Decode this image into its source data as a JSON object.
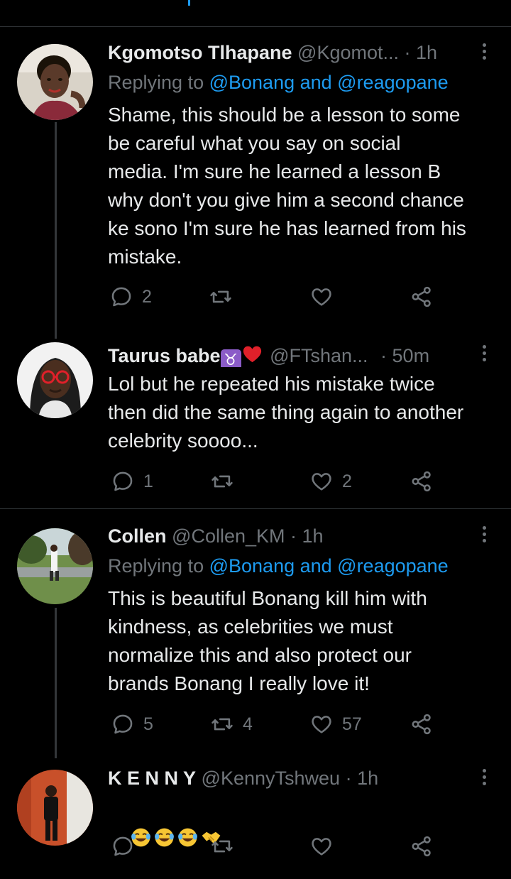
{
  "tweets": [
    {
      "name": "Kgomotso Tlhapane",
      "handle": "@Kgomot...",
      "time": "· 1h",
      "replying_label": "Replying to",
      "replying_to": "@Bonang and @reagopane",
      "text": "Shame, this should be a lesson to some\nbe careful what you say on social\nmedia. I'm sure he learned a lesson B\nwhy don't you give him a second chance\nke sono I'm sure he has learned from his\nmistake.",
      "reply_count": "2",
      "retweet_count": "",
      "like_count": "",
      "avatar_colors": {
        "bg": "#d9d3c8",
        "skin": "#5a3a2a",
        "hair": "#1a1208"
      }
    },
    {
      "name": "Taurus babe",
      "name_badges": [
        "taurus-sign-icon",
        "red-heart-icon"
      ],
      "taurus_glyph": "♉",
      "handle": "@FTshan...",
      "time": "· 50m",
      "text": "Lol but he repeated his mistake twice\nthen did the same thing again to another\ncelebrity soooo...",
      "reply_count": "1",
      "retweet_count": "",
      "like_count": "2",
      "avatar_colors": {
        "bg": "#f2f2f2",
        "skin": "#4a2e1f",
        "glasses": "#e0202a"
      }
    },
    {
      "name": "Collen",
      "handle": "@Collen_KM",
      "time": "· 1h",
      "replying_label": "Replying to",
      "replying_to": "@Bonang and @reagopane",
      "text": "This is beautiful Bonang kill him with\nkindness, as celebrities we must\nnormalize this and also protect our\nbrands Bonang I really love it!",
      "reply_count": "5",
      "retweet_count": "4",
      "like_count": "57",
      "avatar_colors": {
        "bg": "#6f8f4a",
        "sky": "#c9d6d8",
        "shirt": "#f4f4f4"
      }
    },
    {
      "name": "K E N N Y",
      "handle": "@KennyTshweu",
      "time": "· 1h",
      "text_emojis": [
        "face-with-tears-of-joy-icon",
        "face-with-tears-of-joy-icon",
        "face-with-tears-of-joy-icon",
        "handshake-icon"
      ],
      "avatar_colors": {
        "bg": "#c8502a",
        "person": "#111111"
      }
    }
  ],
  "colors": {
    "background": "#000000",
    "text": "#e7e9ea",
    "muted": "#71767b",
    "link": "#1d9bf0",
    "divider": "#2f3336"
  }
}
